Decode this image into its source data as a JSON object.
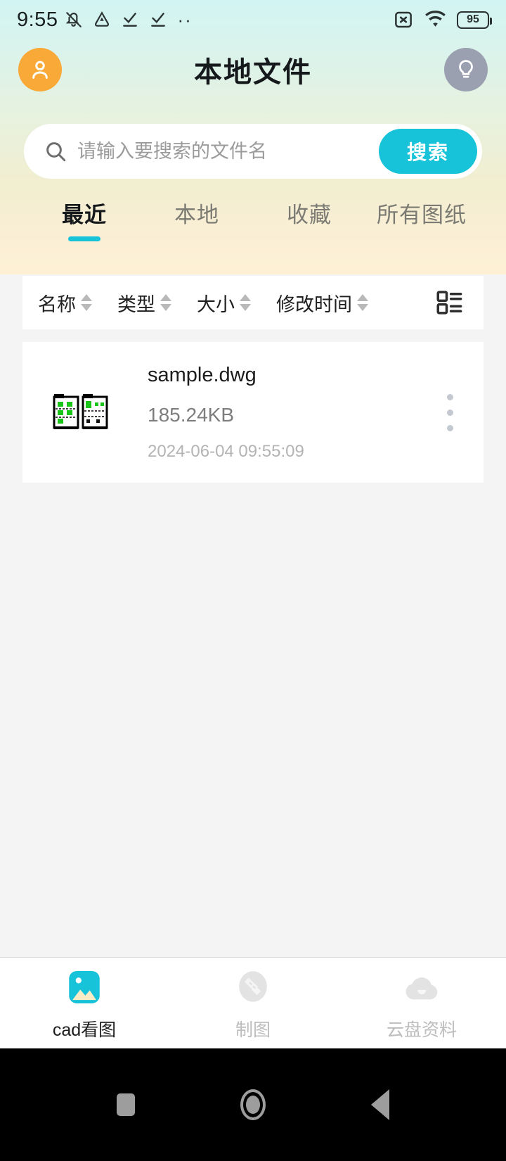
{
  "statusbar": {
    "time": "9:55",
    "dots": "··",
    "battery_level": "95",
    "icons": [
      "mute-icon",
      "drive-triangle-icon",
      "download-check-icon",
      "download-check-icon",
      "more-dots-icon",
      "sim-disabled-icon",
      "wifi-icon",
      "battery-icon"
    ]
  },
  "header": {
    "title": "本地文件",
    "avatar_icon": "user-avatar-icon",
    "avatar_color": "#f9a938",
    "bulb_icon": "lightbulb-icon",
    "bulb_color": "#9ba0b0",
    "gradient_top": "#d2f4f3",
    "gradient_bottom": "#fdf0d5"
  },
  "search": {
    "placeholder": "请输入要搜索的文件名",
    "value": "",
    "button_label": "搜索",
    "button_color": "#17c3d8",
    "icon": "search-icon"
  },
  "tabs": [
    {
      "label": "最近",
      "active": true
    },
    {
      "label": "本地",
      "active": false
    },
    {
      "label": "收藏",
      "active": false
    },
    {
      "label": "所有图纸",
      "active": false
    }
  ],
  "sortbar": {
    "items": [
      {
        "label": "名称"
      },
      {
        "label": "类型"
      },
      {
        "label": "大小"
      },
      {
        "label": "修改时间"
      }
    ],
    "view_toggle_icon": "list-view-icon"
  },
  "files": [
    {
      "name": "sample.dwg",
      "size": "185.24KB",
      "modified": "2024-06-04 09:55:09",
      "thumbnail": "cad-drawing-thumbnail",
      "menu_icon": "more-vertical-icon"
    }
  ],
  "bottom_nav": [
    {
      "label": "cad看图",
      "icon": "image-viewer-icon",
      "active": true,
      "color": "#17c3d8"
    },
    {
      "label": "制图",
      "icon": "drafting-icon",
      "active": false,
      "color": "#e2e2e2"
    },
    {
      "label": "云盘资料",
      "icon": "cloud-icon",
      "active": false,
      "color": "#e2e2e2"
    }
  ],
  "system_nav": [
    {
      "icon": "recents-square-icon"
    },
    {
      "icon": "home-circle-icon"
    },
    {
      "icon": "back-triangle-icon"
    }
  ]
}
